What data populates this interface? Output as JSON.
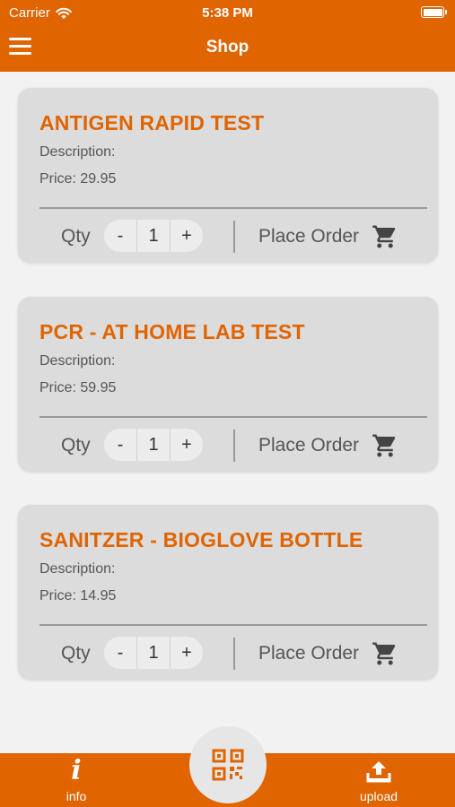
{
  "status_bar": {
    "carrier": "Carrier",
    "time": "5:38 PM",
    "battery_level": 1.0
  },
  "nav": {
    "title": "Shop",
    "menu_icon": "hamburger-menu-icon"
  },
  "products": [
    {
      "name": "ANTIGEN RAPID TEST",
      "description": "Description:",
      "price": "Price: 29.95",
      "qty_label": "Qty",
      "minus": "-",
      "qty": "1",
      "plus": "+",
      "order_label": "Place Order"
    },
    {
      "name": "PCR - AT HOME LAB TEST",
      "description": "Description:",
      "price": "Price: 59.95",
      "qty_label": "Qty",
      "minus": "-",
      "qty": "1",
      "plus": "+",
      "order_label": "Place Order"
    },
    {
      "name": "SANITZER - BIOGLOVE BOTTLE",
      "description": "Description:",
      "price": "Price: 14.95",
      "qty_label": "Qty",
      "minus": "-",
      "qty": "1",
      "plus": "+",
      "order_label": "Place Order"
    }
  ],
  "tab_bar": {
    "info": {
      "label": "info",
      "icon": "info-icon"
    },
    "scan": {
      "icon": "qr-code-icon"
    },
    "upload": {
      "label": "upload",
      "icon": "upload-icon"
    }
  },
  "colors": {
    "accent": "#e06400",
    "card": "#dcdcdc",
    "background": "#f2f2f2"
  }
}
